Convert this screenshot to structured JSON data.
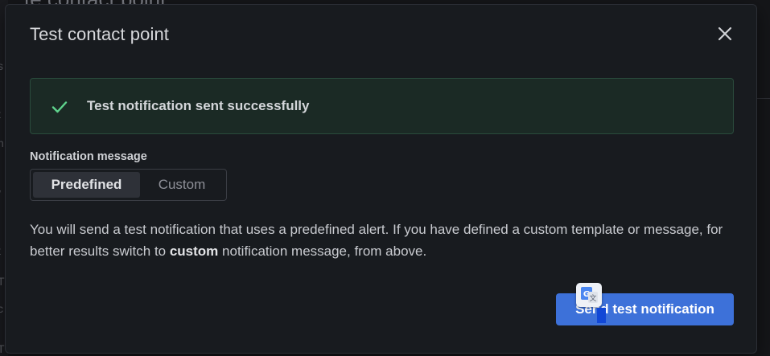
{
  "background": {
    "page_title": "te contact point",
    "side_letters": [
      "s",
      "t",
      "n",
      "/",
      "t",
      "T",
      "c",
      "T"
    ]
  },
  "modal": {
    "title": "Test contact point",
    "close_icon": "close-icon"
  },
  "alert": {
    "icon": "check-icon",
    "message": "Test notification sent successfully",
    "color": "#5fd38d"
  },
  "notification_message": {
    "label": "Notification message",
    "options": [
      "Predefined",
      "Custom"
    ],
    "selected": "Predefined"
  },
  "description": {
    "part1": "You will send a test notification that uses a predefined alert. If you have defined a custom template or message, for better results switch to ",
    "emphasis": "custom",
    "part2": " notification message, from above."
  },
  "send_button": {
    "label": "Send test notification",
    "color": "#3d71d9"
  },
  "translate_widget": {
    "icon": "google-translate-icon"
  }
}
